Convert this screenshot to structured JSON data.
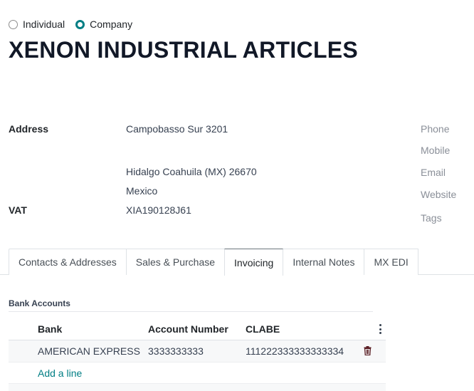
{
  "partner_type": {
    "options": [
      {
        "label": "Individual",
        "checked": false
      },
      {
        "label": "Company",
        "checked": true
      }
    ]
  },
  "partner": {
    "name": "XENON INDUSTRIAL ARTICLES",
    "address_label": "Address",
    "street": "Campobasso Sur 3201",
    "city_line": "Hidalgo  Coahuila (MX)  26670",
    "country": "Mexico",
    "vat_label": "VAT",
    "vat": "XIA190128J61"
  },
  "side_fields": [
    "Phone",
    "Mobile",
    "Email",
    "Website",
    "Tags"
  ],
  "tabs": [
    {
      "label": "Contacts & Addresses",
      "active": false
    },
    {
      "label": "Sales & Purchase",
      "active": false
    },
    {
      "label": "Invoicing",
      "active": true
    },
    {
      "label": "Internal Notes",
      "active": false
    },
    {
      "label": "MX EDI",
      "active": false
    }
  ],
  "bank_accounts": {
    "title": "Bank Accounts",
    "columns": {
      "bank": "Bank",
      "account": "Account Number",
      "clabe": "CLABE"
    },
    "rows": [
      {
        "bank": "AMERICAN EXPRESS",
        "account": "3333333333",
        "clabe": "111222333333333334"
      }
    ],
    "add_line": "Add a line"
  },
  "colors": {
    "accent": "#017e84",
    "muted": "#8a8f98"
  }
}
